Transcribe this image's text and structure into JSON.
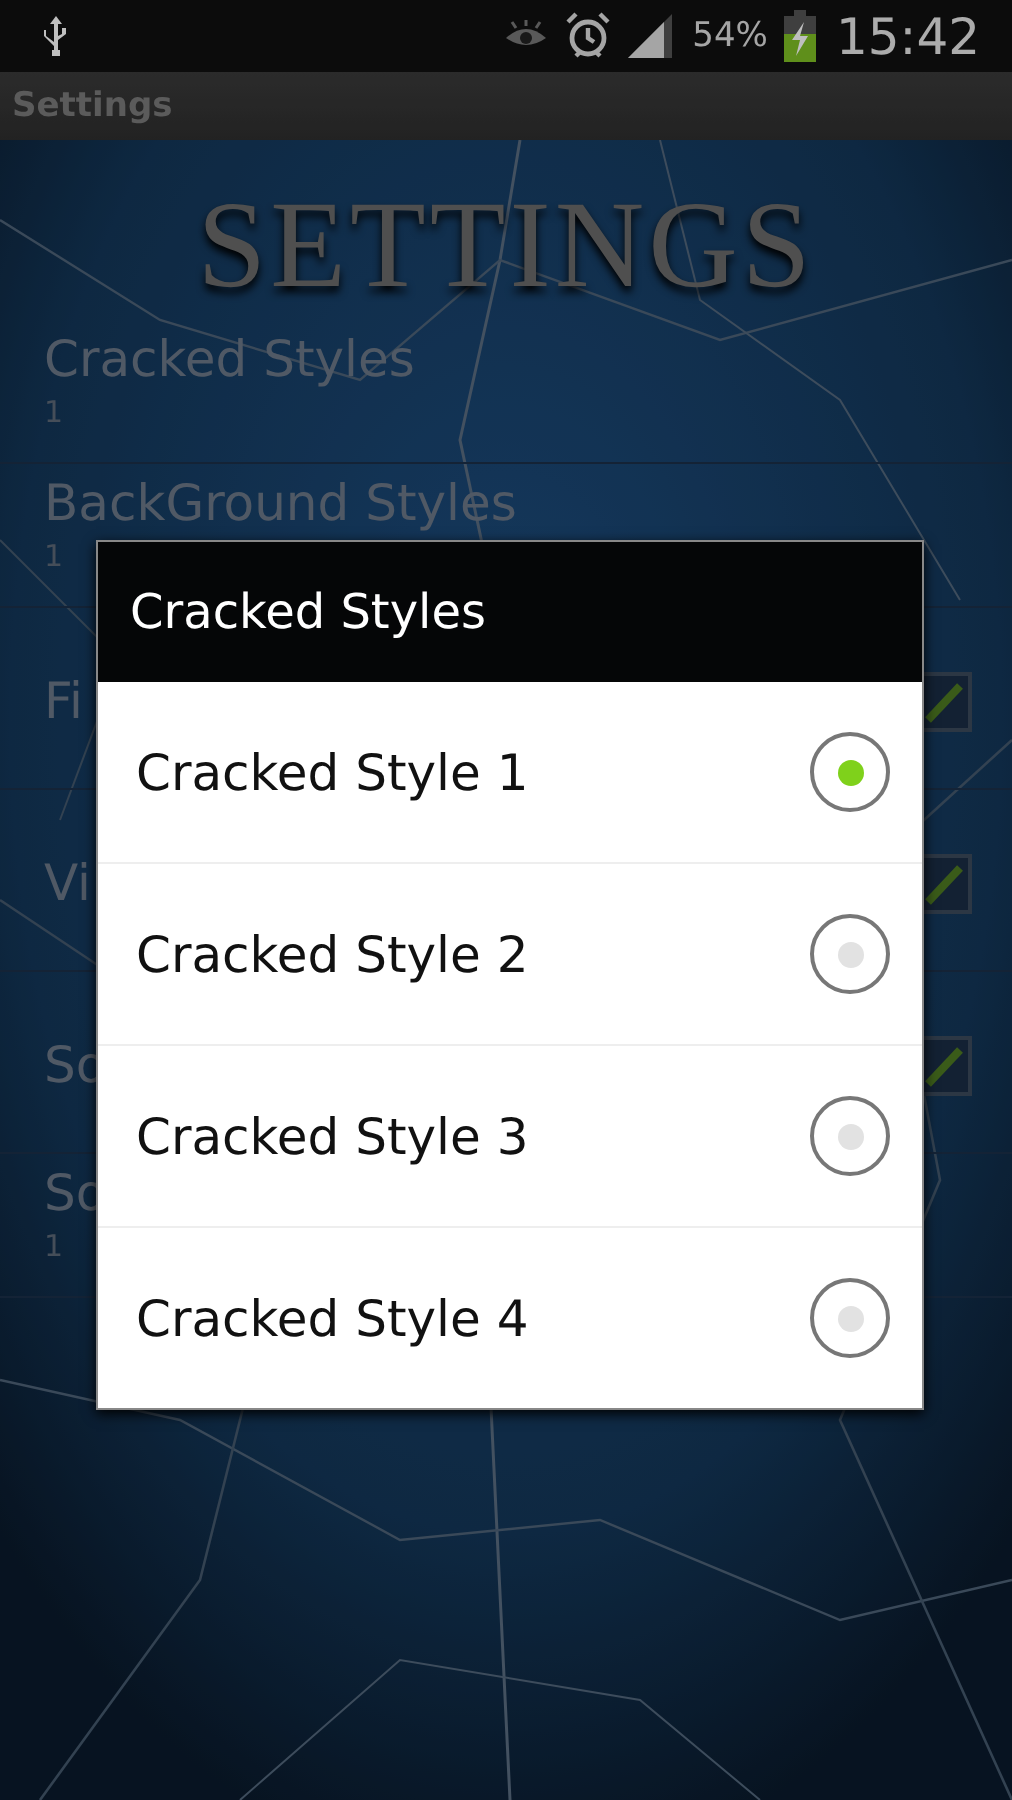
{
  "status_bar": {
    "battery": "54%",
    "time": "15:42"
  },
  "action_bar": {
    "title": "Settings"
  },
  "header": {
    "title": "SETTINGS"
  },
  "preferences": [
    {
      "kind": "list",
      "title": "Cracked Styles",
      "summary": "1"
    },
    {
      "kind": "list",
      "title": "BackGround Styles",
      "summary": "1"
    },
    {
      "kind": "checkbox",
      "title": "Fi",
      "checked": true
    },
    {
      "kind": "checkbox",
      "title": "Vi",
      "checked": true
    },
    {
      "kind": "checkbox",
      "title": "So",
      "checked": true
    },
    {
      "kind": "list",
      "title": "So",
      "summary": "1"
    }
  ],
  "dialog": {
    "title": "Cracked Styles",
    "options": [
      {
        "label": "Cracked Style 1",
        "selected": true
      },
      {
        "label": "Cracked Style 2",
        "selected": false
      },
      {
        "label": "Cracked Style 3",
        "selected": false
      },
      {
        "label": "Cracked Style 4",
        "selected": false
      }
    ]
  }
}
